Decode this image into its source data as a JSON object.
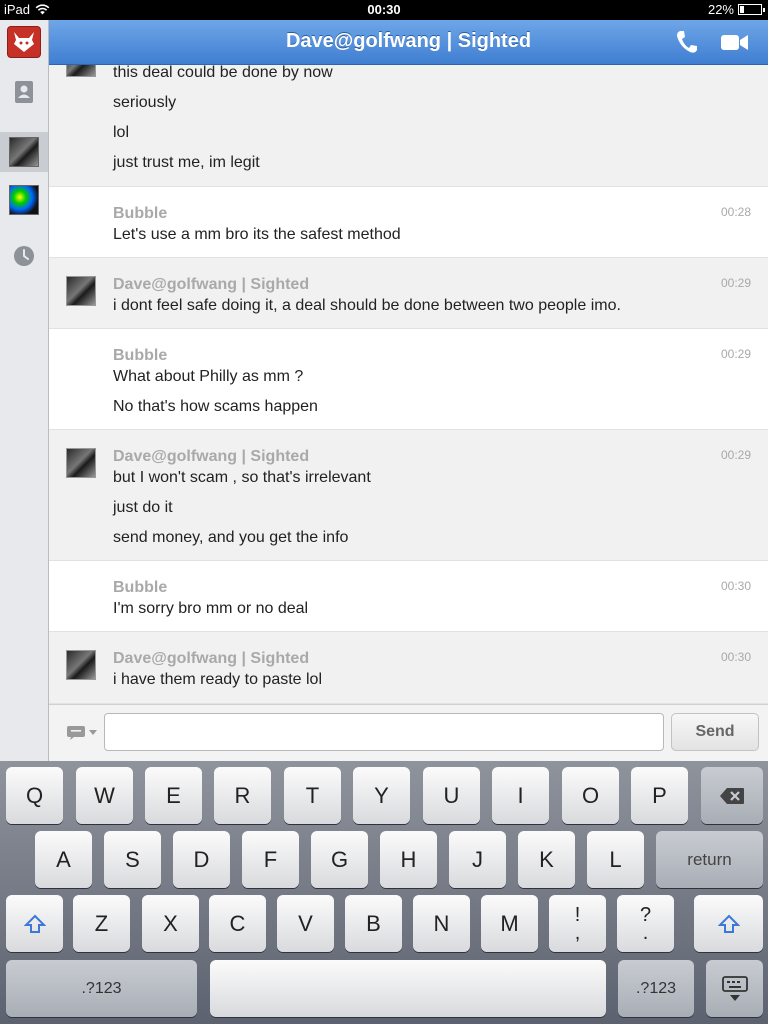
{
  "status_bar": {
    "device": "iPad",
    "time": "00:30",
    "battery": "22%",
    "battery_level": 0.22
  },
  "header": {
    "title": "Dave@golfwang | Sighted"
  },
  "sidebar": {
    "items": [
      {
        "name": "app-logo",
        "icon": "devil-icon"
      },
      {
        "name": "contacts",
        "icon": "contacts-icon"
      },
      {
        "name": "conversation-dave",
        "icon": "avatar"
      },
      {
        "name": "conversation-other",
        "icon": "avatar"
      },
      {
        "name": "recent",
        "icon": "clock-icon"
      }
    ]
  },
  "messages": [
    {
      "sender": "",
      "time": "",
      "lines": [
        "this deal could be done by now",
        "seriously",
        "lol",
        "just trust me, im legit"
      ]
    },
    {
      "sender": "Bubble",
      "time": "00:28",
      "lines": [
        "Let's use a mm bro its the safest method"
      ]
    },
    {
      "sender": "Dave@golfwang | Sighted",
      "time": "00:29",
      "lines": [
        "i dont feel safe doing it, a deal should be done between two people imo."
      ]
    },
    {
      "sender": "Bubble",
      "time": "00:29",
      "lines": [
        "What about Philly as mm ?",
        "No that's how scams happen"
      ]
    },
    {
      "sender": "Dave@golfwang | Sighted",
      "time": "00:29",
      "lines": [
        "but I won't scam , so that's irrelevant",
        "just do it",
        "send money, and you get the info"
      ]
    },
    {
      "sender": "Bubble",
      "time": "00:30",
      "lines": [
        "I'm sorry bro mm or no deal"
      ]
    },
    {
      "sender": "Dave@golfwang | Sighted",
      "time": "00:30",
      "lines": [
        "i have them ready to paste lol"
      ]
    }
  ],
  "composer": {
    "placeholder": "",
    "send_label": "Send"
  },
  "keyboard": {
    "row1": [
      "Q",
      "W",
      "E",
      "R",
      "T",
      "Y",
      "U",
      "I",
      "O",
      "P"
    ],
    "row2": [
      "A",
      "S",
      "D",
      "F",
      "G",
      "H",
      "J",
      "K",
      "L"
    ],
    "return_label": "return",
    "row3": [
      "Z",
      "X",
      "C",
      "V",
      "B",
      "N",
      "M"
    ],
    "punct1": [
      "!",
      ","
    ],
    "punct2": [
      "?",
      "."
    ],
    "numbers_label": ".?123"
  },
  "colors": {
    "header_top": "#6fa6e8",
    "header_bottom": "#3f7ed1",
    "accent_blue": "#3b78d8"
  }
}
